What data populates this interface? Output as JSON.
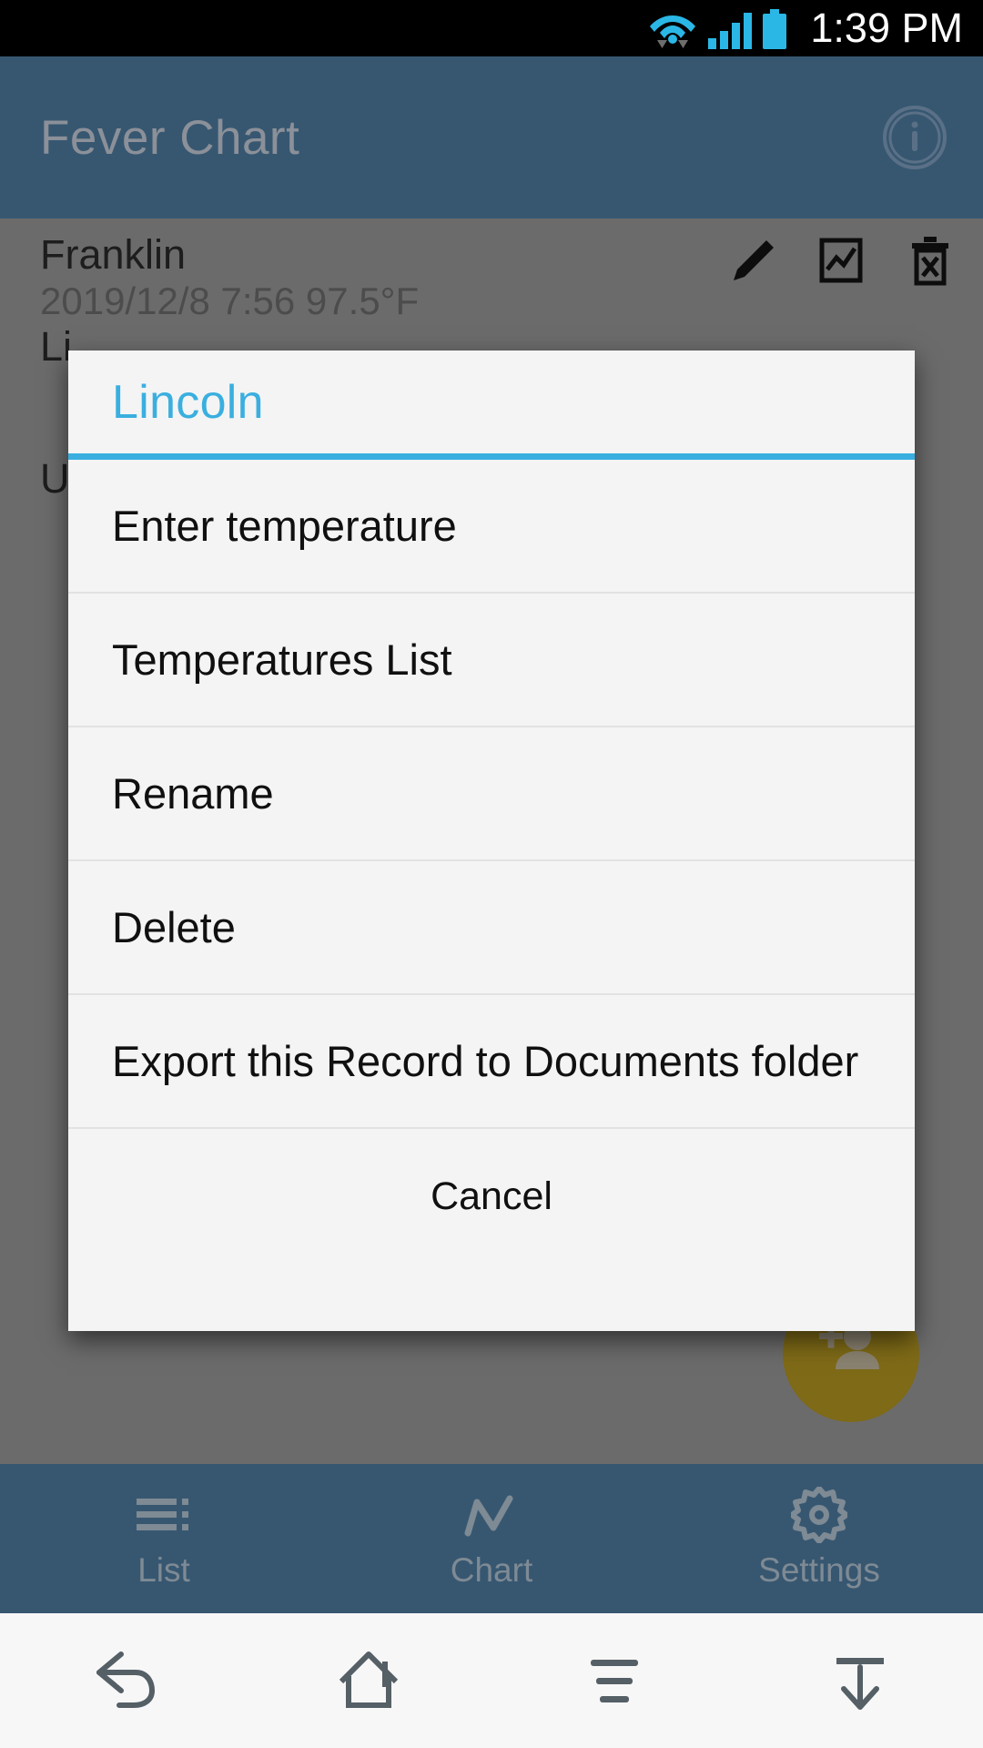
{
  "status_bar": {
    "time": "1:39 PM",
    "icons": [
      "wifi-icon",
      "data-transfer-icon",
      "cellular-signal-icon",
      "battery-icon"
    ],
    "accent_color": "#2ab7e6",
    "background_color": "#000000"
  },
  "app_bar": {
    "title": "Fever Chart",
    "info_icon": "info-circle-icon",
    "background_color": "#375771",
    "title_color": "#8b9099"
  },
  "content": {
    "record": {
      "name": "Franklin",
      "details": "2019/12/8 7:56   97.5°F",
      "actions": [
        "edit-pencil-icon",
        "chart-icon",
        "delete-trash-icon"
      ]
    },
    "background_items": [
      {
        "label": "Li"
      },
      {
        "label": "U"
      }
    ],
    "fab": {
      "icon": "add-person-icon",
      "color": "#7e6a17"
    }
  },
  "dialog": {
    "title": "Lincoln",
    "title_color": "#3aafdf",
    "background_color": "#f4f4f4",
    "items": [
      {
        "label": "Enter temperature"
      },
      {
        "label": "Temperatures List"
      },
      {
        "label": "Rename"
      },
      {
        "label": "Delete"
      },
      {
        "label": "Export this Record to Documents folder"
      }
    ],
    "cancel_label": "Cancel"
  },
  "tab_bar": {
    "background_color": "#375771",
    "tabs": [
      {
        "label": "List",
        "icon": "list-icon"
      },
      {
        "label": "Chart",
        "icon": "line-chart-icon"
      },
      {
        "label": "Settings",
        "icon": "gear-icon"
      }
    ]
  },
  "nav_bar": {
    "background_color": "#f7f7f7",
    "buttons": [
      {
        "icon": "back-arrow-icon"
      },
      {
        "icon": "home-icon"
      },
      {
        "icon": "menu-icon"
      },
      {
        "icon": "hide-keyboard-icon"
      }
    ]
  }
}
